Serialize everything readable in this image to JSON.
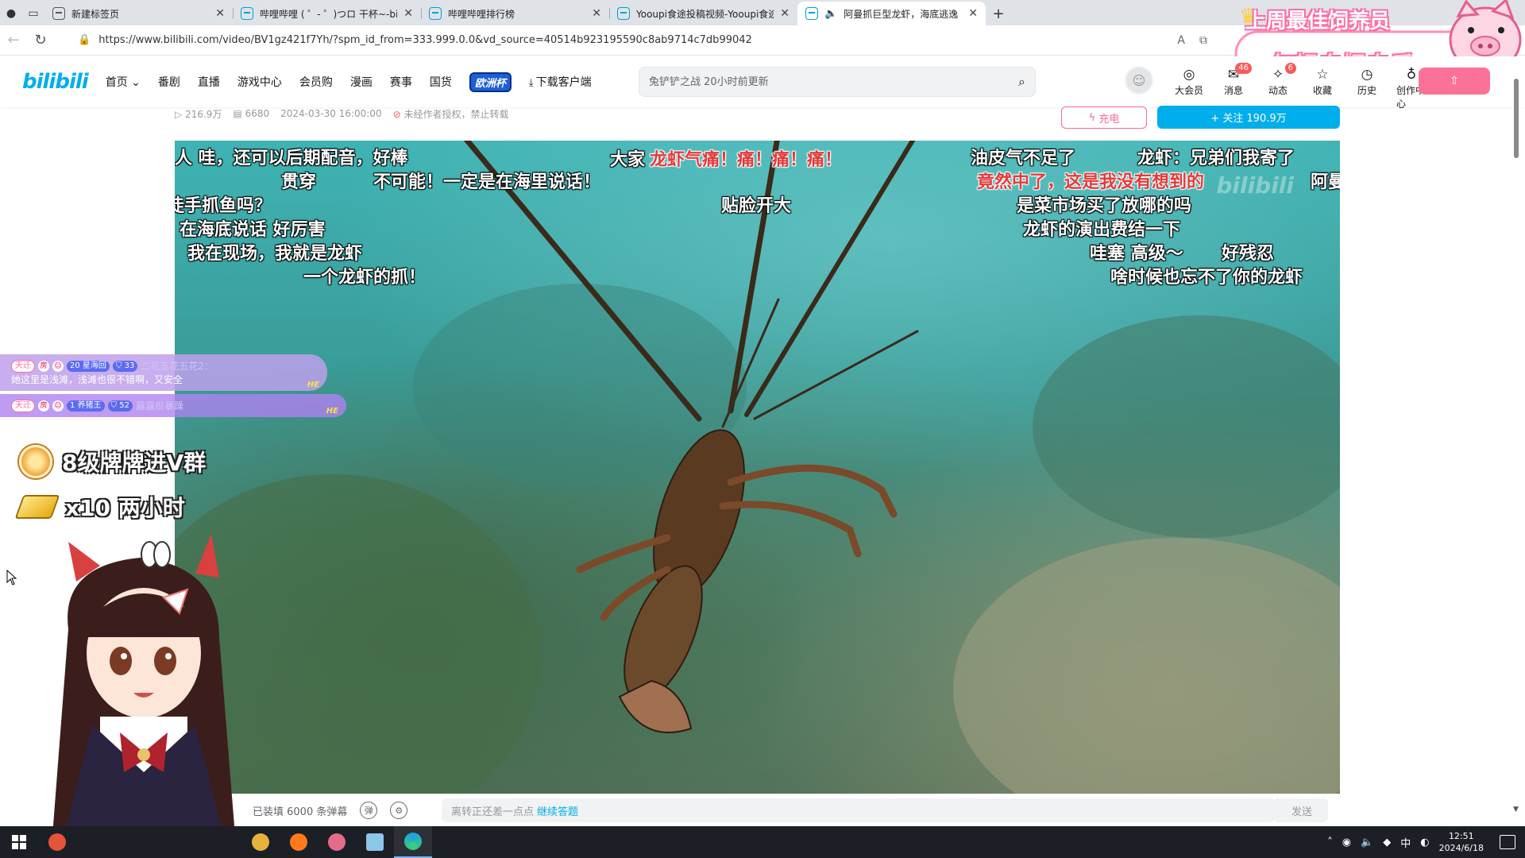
{
  "browser": {
    "tabs": [
      {
        "title": "新建标签页",
        "icon": "page-icon",
        "active": false
      },
      {
        "title": "哔哩哔哩 ( ゜- ゜)つロ 干杯~-bili",
        "icon": "bilibili-tv-icon",
        "active": false
      },
      {
        "title": "哔哩哔哩排行榜",
        "icon": "bilibili-tv-icon",
        "active": false
      },
      {
        "title": "Yooupi食途投稿视频-Yooupi食途",
        "icon": "bilibili-tv-icon",
        "active": false
      },
      {
        "title": "阿曼抓巨型龙虾，海底逃逸",
        "icon": "bilibili-tv-icon",
        "active": true,
        "audio": true
      }
    ],
    "url": "https://www.bilibili.com/video/BV1gz421f7Yh/?spm_id_from=333.999.0.0&vd_source=40514b923195590c8ab9714c7db99042"
  },
  "header": {
    "logo": "bilibili",
    "nav": [
      {
        "label": "首页",
        "dropdown": true
      },
      {
        "label": "番剧"
      },
      {
        "label": "直播"
      },
      {
        "label": "游戏中心"
      },
      {
        "label": "会员购"
      },
      {
        "label": "漫画"
      },
      {
        "label": "赛事"
      },
      {
        "label": "国货"
      },
      {
        "label": "欧洲杯",
        "style": "badge"
      },
      {
        "label": "下载客户端",
        "icon": "download-icon"
      }
    ],
    "search_placeholder": "兔铲铲之战 20小时前更新",
    "user_items": [
      {
        "label": "大会员",
        "icon": "vip-icon"
      },
      {
        "label": "消息",
        "icon": "message-icon",
        "badge": "46"
      },
      {
        "label": "动态",
        "icon": "dynamic-icon",
        "badge": "6"
      },
      {
        "label": "收藏",
        "icon": "star-icon"
      },
      {
        "label": "历史",
        "icon": "history-icon"
      },
      {
        "label": "创作中心",
        "icon": "bulb-icon"
      }
    ]
  },
  "video_info": {
    "views": "216.9万",
    "danmaku_count": "6680",
    "date": "2024-03-30 16:00:00",
    "copyright": "未经作者授权，禁止转载",
    "charge_label": "充电",
    "follow_label": "+ 关注 190.9万"
  },
  "player": {
    "watermark": "bilibili",
    "danmaku": [
      {
        "text": "人 哇，还可以后期配音，好棒",
        "color": "#ffffff"
      },
      {
        "text": "贯穿",
        "color": "#ffffff"
      },
      {
        "text": "不可能！一定是在海里说话！",
        "color": "#ffffff"
      },
      {
        "text": "大家",
        "color": "#ffffff"
      },
      {
        "text": "龙虾气痛！痛！痛！痛！",
        "color": "#e33a3a"
      },
      {
        "text": "油皮气不足了",
        "color": "#ffffff"
      },
      {
        "text": "龙虾：兄弟们我寄了",
        "color": "#ffffff"
      },
      {
        "text": "竟然中了，这是我没有想到的",
        "color": "#e33a3a"
      },
      {
        "text": "阿曼",
        "color": "#ffffff"
      },
      {
        "text": "徒手抓鱼吗？",
        "color": "#ffffff"
      },
      {
        "text": "贴脸开大",
        "color": "#ffffff"
      },
      {
        "text": "是菜市场买了放哪的吗",
        "color": "#ffffff"
      },
      {
        "text": "在海底说话 好厉害",
        "color": "#ffffff"
      },
      {
        "text": "龙虾的演出费结一下",
        "color": "#ffffff"
      },
      {
        "text": "我在现场，我就是龙虾",
        "color": "#ffffff"
      },
      {
        "text": "哇塞 高级～",
        "color": "#ffffff"
      },
      {
        "text": "好残忍",
        "color": "#ffffff"
      },
      {
        "text": "一个龙虾的抓！",
        "color": "#ffffff"
      },
      {
        "text": "啥时候也忘不了你的龙虾",
        "color": "#ffffff"
      }
    ],
    "danmaku_bar": {
      "loaded": "已装填 6000 条弹幕",
      "input_hint": "离转正还差一点点",
      "input_link": "继续答题",
      "send": "发送"
    }
  },
  "stream_overlay": {
    "chat": [
      {
        "fan_badge": "天迁",
        "level": "20 星海回",
        "guard": "33",
        "user": "二花五花五花2：",
        "text": "她这里是浅滩，浅滩也很不错啊，又安全",
        "tag": "HE"
      },
      {
        "fan_badge": "天迁",
        "level": "1 养猪王",
        "guard": "52",
        "user": "露露很暴躁",
        "text": "",
        "tag": "HE"
      }
    ],
    "rewards": [
      {
        "text": "8级牌牌进V群",
        "icon": "medal-icon"
      },
      {
        "text": "x10 两小时",
        "icon": "gold-bar-icon"
      }
    ],
    "top_right_title": "上周最佳饲养员",
    "top_right_sub": "年轻自娱自乐"
  },
  "taskbar": {
    "time": "12:51",
    "date": "2024/6/18",
    "ime": "中"
  }
}
